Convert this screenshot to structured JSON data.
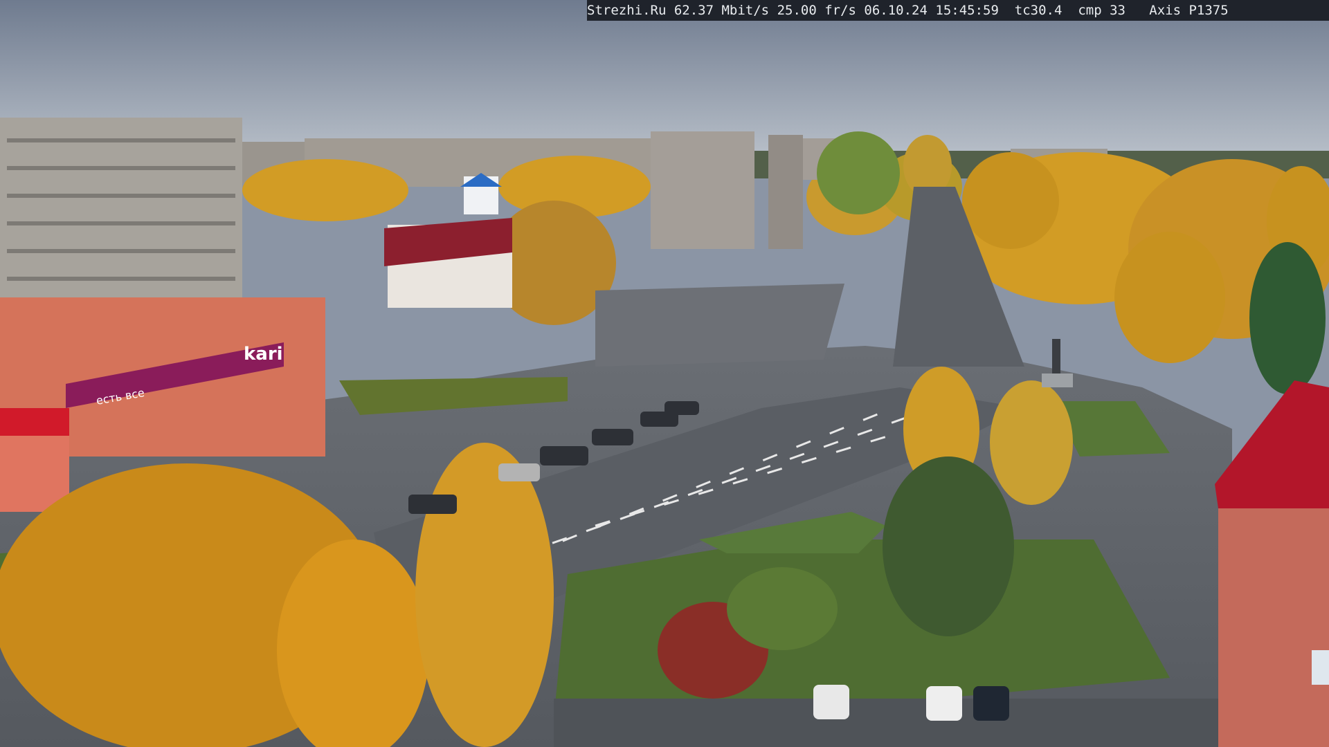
{
  "overlay": {
    "site": "Strezhi.Ru",
    "bitrate": "62.37 Mbit/s",
    "framerate": "25.00 fr/s",
    "date": "06.10.24",
    "time": "15:45:59",
    "tc": "tc30.4",
    "cmp": "cmp 33",
    "camera": "Axis P1375"
  },
  "signs": {
    "store_logo": "kari",
    "store_banner": "есть все"
  },
  "colors": {
    "sky_top": "#6f7b8f",
    "sky_bottom": "#b7bec8",
    "trees": "#d8a12a",
    "road": "#5e6268",
    "grass": "#4d6b2f",
    "store_banner": "#8a1c5a",
    "roof_red": "#b3162a"
  }
}
